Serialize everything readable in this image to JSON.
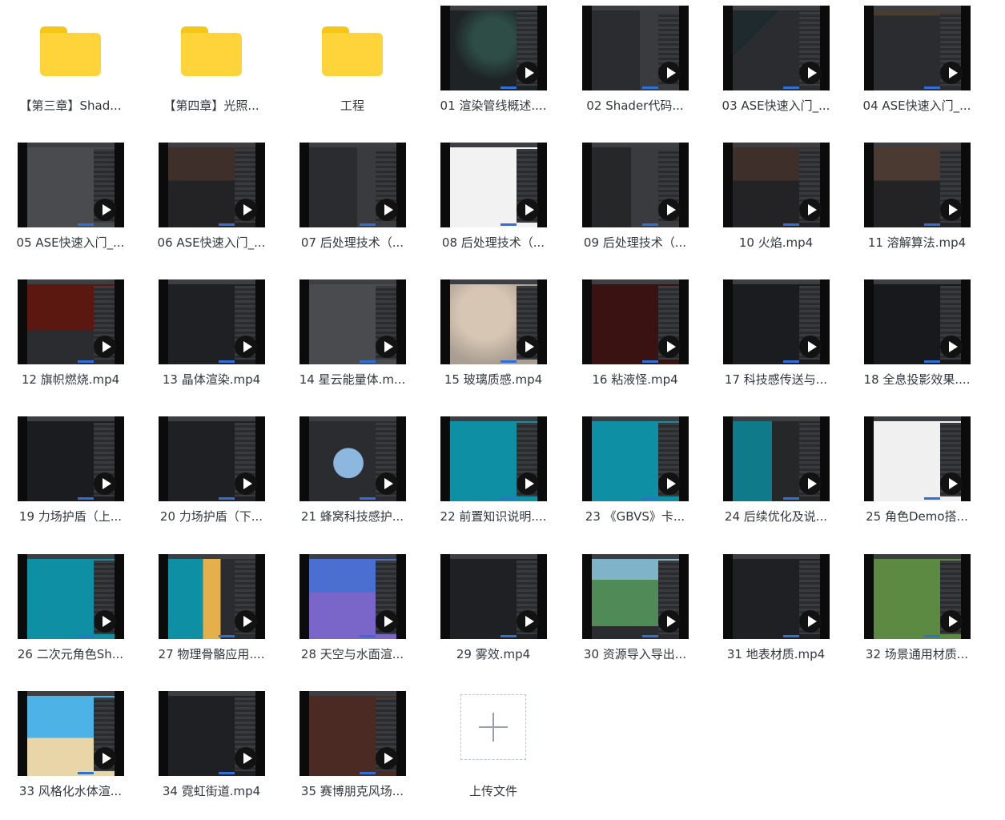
{
  "files": [
    {
      "label": "【第三章】Shad...",
      "type": "folder"
    },
    {
      "label": "【第四章】光照...",
      "type": "folder"
    },
    {
      "label": "工程",
      "type": "folder"
    },
    {
      "label": "01 渲染管线概述....",
      "type": "video",
      "theme": "diagram"
    },
    {
      "label": "02 Shader代码...",
      "type": "video",
      "theme": "editor"
    },
    {
      "label": "03 ASE快速入门_...",
      "type": "video",
      "theme": "editor-cyan"
    },
    {
      "label": "04 ASE快速入门_...",
      "type": "video",
      "theme": "editor-green"
    },
    {
      "label": "05 ASE快速入门_...",
      "type": "video",
      "theme": "red-hook"
    },
    {
      "label": "06 ASE快速入门_...",
      "type": "video",
      "theme": "brown"
    },
    {
      "label": "07 后处理技术（...",
      "type": "video",
      "theme": "editor"
    },
    {
      "label": "08 后处理技术（...",
      "type": "video",
      "theme": "white-doc"
    },
    {
      "label": "09 后处理技术（...",
      "type": "video",
      "theme": "editor-pink"
    },
    {
      "label": "10 火焰.mp4",
      "type": "video",
      "theme": "brown"
    },
    {
      "label": "11 溶解算法.mp4",
      "type": "video",
      "theme": "brown-white"
    },
    {
      "label": "12 旗帜燃烧.mp4",
      "type": "video",
      "theme": "red-dark"
    },
    {
      "label": "13 晶体渲染.mp4",
      "type": "video",
      "theme": "dark-nodes"
    },
    {
      "label": "14 星云能量体.m...",
      "type": "video",
      "theme": "grey-figure"
    },
    {
      "label": "15 玻璃质感.mp4",
      "type": "video",
      "theme": "beige-statue"
    },
    {
      "label": "16 粘液怪.mp4",
      "type": "video",
      "theme": "red-ghost"
    },
    {
      "label": "17 科技感传送与...",
      "type": "video",
      "theme": "dark"
    },
    {
      "label": "18 全息投影效果....",
      "type": "video",
      "theme": "dark-blue"
    },
    {
      "label": "19 力场护盾（上...",
      "type": "video",
      "theme": "dark"
    },
    {
      "label": "20 力场护盾（下...",
      "type": "video",
      "theme": "dark-sphere"
    },
    {
      "label": "21 蜂窝科技感护...",
      "type": "video",
      "theme": "blue-sphere"
    },
    {
      "label": "22 前置知识说明....",
      "type": "video",
      "theme": "teal-char"
    },
    {
      "label": "23 《GBVS》卡...",
      "type": "video",
      "theme": "teal-char"
    },
    {
      "label": "24 后续优化及说...",
      "type": "video",
      "theme": "teal-dark"
    },
    {
      "label": "25 角色Demo搭...",
      "type": "video",
      "theme": "white-pink"
    },
    {
      "label": "26 二次元角色Sh...",
      "type": "video",
      "theme": "teal-char"
    },
    {
      "label": "27 物理骨骼应用....",
      "type": "video",
      "theme": "teal-yellow"
    },
    {
      "label": "28 天空与水面渲...",
      "type": "video",
      "theme": "sky-purple"
    },
    {
      "label": "29 雾效.mp4",
      "type": "video",
      "theme": "dark-nodes"
    },
    {
      "label": "30 资源导入导出...",
      "type": "video",
      "theme": "landscape"
    },
    {
      "label": "31 地表材质.mp4",
      "type": "video",
      "theme": "dark-nodes"
    },
    {
      "label": "32 场景通用材质...",
      "type": "video",
      "theme": "green-land"
    },
    {
      "label": "33 风格化水体渲...",
      "type": "video",
      "theme": "beach"
    },
    {
      "label": "34 霓虹街道.mp4",
      "type": "video",
      "theme": "dark-nodes"
    },
    {
      "label": "35 赛博朋克风场...",
      "type": "video",
      "theme": "cyber"
    },
    {
      "label": "上传文件",
      "type": "upload"
    }
  ],
  "icons": {
    "folder": "folder-icon",
    "video": "video-thumbnail",
    "play": "play-icon",
    "upload": "plus-icon"
  },
  "colors": {
    "folder": "#ffd43b",
    "label": "#33373d",
    "play_badge": "#121212"
  }
}
